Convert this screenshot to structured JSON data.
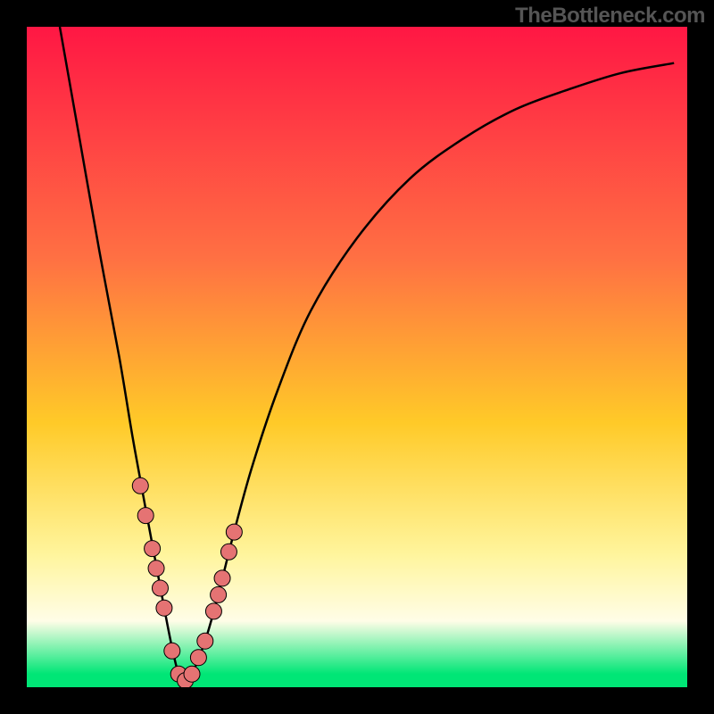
{
  "watermark": "TheBottleneck.com",
  "colors": {
    "frame": "#000000",
    "curve": "#000000",
    "dot_fill": "#e57373",
    "dot_stroke": "#000000",
    "grad_top": "#ff1744",
    "grad_mid_upper": "#ff7043",
    "grad_mid": "#ffca28",
    "grad_mid_lower": "#fff59d",
    "grad_band": "#fffde7",
    "grad_bottom": "#00e676"
  },
  "chart_data": {
    "type": "line",
    "title": "",
    "xlabel": "",
    "ylabel": "",
    "xlim": [
      0,
      100
    ],
    "ylim": [
      0,
      100
    ],
    "series": [
      {
        "name": "bottleneck-curve",
        "x": [
          5,
          8,
          11,
          14,
          16,
          18,
          19.5,
          21,
          22,
          23,
          24,
          25,
          27,
          29,
          31,
          34,
          38,
          43,
          50,
          58,
          66,
          74,
          82,
          90,
          98
        ],
        "y": [
          100,
          83,
          66,
          50,
          38,
          27,
          19,
          11,
          6,
          2,
          1,
          2,
          7,
          14,
          22,
          33,
          45,
          57,
          68,
          77,
          83,
          87.5,
          90.5,
          93,
          94.5
        ]
      }
    ],
    "points": {
      "name": "highlight-dots",
      "x": [
        17.2,
        18.0,
        19.0,
        19.6,
        20.2,
        20.8,
        22.0,
        23.0,
        24.0,
        25.0,
        26.0,
        27.0,
        28.3,
        29.0,
        29.6,
        30.6,
        31.4
      ],
      "y": [
        30.5,
        26.0,
        21.0,
        18.0,
        15.0,
        12.0,
        5.5,
        2.0,
        1.0,
        2.0,
        4.5,
        7.0,
        11.5,
        14.0,
        16.5,
        20.5,
        23.5
      ]
    },
    "gradient_stops": [
      {
        "offset": 0.0,
        "key": "grad_top"
      },
      {
        "offset": 0.35,
        "key": "grad_mid_upper"
      },
      {
        "offset": 0.6,
        "key": "grad_mid"
      },
      {
        "offset": 0.8,
        "key": "grad_mid_lower"
      },
      {
        "offset": 0.9,
        "key": "grad_band"
      },
      {
        "offset": 0.98,
        "key": "grad_bottom"
      },
      {
        "offset": 1.0,
        "key": "grad_bottom"
      }
    ]
  }
}
